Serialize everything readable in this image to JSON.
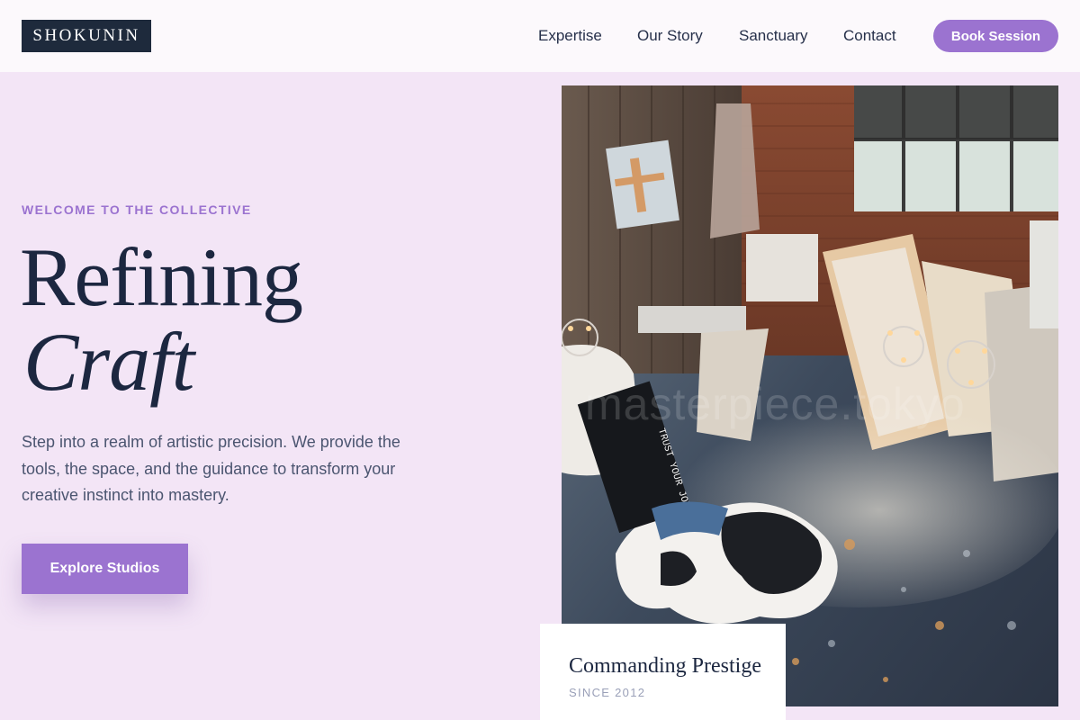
{
  "brand": {
    "logo_text": "SHOKUNIN"
  },
  "nav": {
    "items": [
      {
        "label": "Expertise"
      },
      {
        "label": "Our Story"
      },
      {
        "label": "Sanctuary"
      },
      {
        "label": "Contact"
      }
    ],
    "cta_label": "Book Session"
  },
  "hero": {
    "eyebrow": "WELCOME TO THE COLLECTIVE",
    "title_line1": "Refining",
    "title_line2": "Craft",
    "description": "Step into a realm of artistic precision. We provide the tools, the space, and the guidance to transform your creative instinct into mastery.",
    "cta_label": "Explore Studios"
  },
  "image": {
    "watermark": "masterpiece.tokyo",
    "sign_text": "TRUST YOUR JOURNEY"
  },
  "card": {
    "title": "Commanding Prestige",
    "subtitle": "SINCE 2012"
  },
  "colors": {
    "accent": "#9b73d0",
    "navy": "#1e2a3c",
    "page_background": "#f3e5f6",
    "header_background": "#fcf9fc"
  }
}
